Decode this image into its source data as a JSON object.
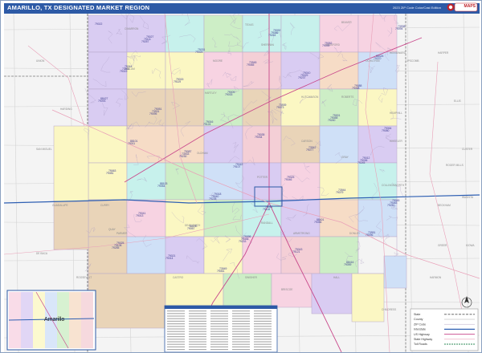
{
  "title": "AMARILLO, TX DESIGNATED MARKET REGION",
  "edition": "2023 ZIP Code Color/Cast Edition",
  "logo_text": "MAPS",
  "inset_city": "Amarillo",
  "legend": {
    "items": [
      "State",
      "County",
      "ZIP Code",
      "Interstate",
      "US Highway",
      "State Highway",
      "Toll Roads"
    ]
  },
  "counties": [
    "DALLAM",
    "HARTLEY",
    "OLDHAM",
    "POTTER",
    "RANDALL",
    "DEAF SMITH",
    "PARMER",
    "CASTRO",
    "SWISHER",
    "BRISCOE",
    "HALL",
    "DONLEY",
    "COLLINGSWORTH",
    "WHEELER",
    "GRAY",
    "CARSON",
    "HUTCHINSON",
    "ROBERTS",
    "HEMPHILL",
    "MOORE",
    "SHERMAN",
    "HANSFORD",
    "OCHILTREE",
    "LIPSCOMB",
    "ARMSTRONG",
    "CHILDRESS",
    "CURRY",
    "QUAY",
    "UNION",
    "HARDING",
    "CIMARRON",
    "TEXAS",
    "BEAVER",
    "HARPER",
    "ELLIS",
    "ROGER MILLS",
    "BECKHAM",
    "GREER",
    "HARMON",
    "WOODWARD",
    "CUSTER",
    "WASHITA",
    "KIOWA",
    "SAN MIGUEL",
    "GUADALUPE",
    "DE BACA",
    "ROOSEVELT",
    "LAMB",
    "HALE"
  ],
  "zip_labels": [
    "79022",
    "79044",
    "79051",
    "79087",
    "79018",
    "79098",
    "79092",
    "79010",
    "79001",
    "79012",
    "79045",
    "79025",
    "79027",
    "79015",
    "79016",
    "79042",
    "79032",
    "79043",
    "79052",
    "79088",
    "79064",
    "79063",
    "79041",
    "79021",
    "79031",
    "79009",
    "79035",
    "79325",
    "88401",
    "88416",
    "88426",
    "88427",
    "88101",
    "88103",
    "88130",
    "73949",
    "73945",
    "73939",
    "73942",
    "73944",
    "73951",
    "73938",
    "73901",
    "73931",
    "73933",
    "79040",
    "79084",
    "79086",
    "79029",
    "79058",
    "79036",
    "79083",
    "79108",
    "79111",
    "79119",
    "79124",
    "79107",
    "79118",
    "79121",
    "79039",
    "79068",
    "79080",
    "79081",
    "79013",
    "79014",
    "79024",
    "79033",
    "79034",
    "79046",
    "79056",
    "79059",
    "79070",
    "79093",
    "79011",
    "79054",
    "79057",
    "79061",
    "79065",
    "79073",
    "79077",
    "79079",
    "79096",
    "79094",
    "79019",
    "79095",
    "79230",
    "79226",
    "79233",
    "79261",
    "79237",
    "79240",
    "79245",
    "79251",
    "79255",
    "79257"
  ],
  "colors": {
    "violet": "#d9ccf2",
    "pink": "#f7d3e2",
    "yellow": "#fbf7c3",
    "green": "#cdeec6",
    "cyan": "#c7f1ec",
    "tan": "#e9d4b8",
    "peach": "#f6dcc6",
    "blue": "#cfe0f7",
    "mint": "#d8f2e3",
    "rose": "#f4cfd6",
    "outside": "#f4f4f4",
    "title_bg": "#2d5aa6",
    "interstate": "#2e5fb3",
    "highway": "#c94a8c",
    "road": "#e9a0b8",
    "state_line": "#777777"
  },
  "map_data": {
    "blocks": [
      {
        "col": 0,
        "row": 0,
        "c": "violet"
      },
      {
        "col": 1,
        "row": 0,
        "c": "violet"
      },
      {
        "col": 2,
        "row": 0,
        "c": "cyan"
      },
      {
        "col": 3,
        "row": 0,
        "c": "green"
      },
      {
        "col": 4,
        "row": 0,
        "c": "cyan"
      },
      {
        "col": 5,
        "row": 0,
        "c": "cyan"
      },
      {
        "col": 6,
        "row": 0,
        "c": "pink"
      },
      {
        "col": 7,
        "row": 0,
        "c": "pink"
      },
      {
        "col": 0,
        "row": 1,
        "c": "violet"
      },
      {
        "col": 1,
        "row": 1,
        "c": "yellow"
      },
      {
        "col": 2,
        "row": 1,
        "c": "yellow"
      },
      {
        "col": 3,
        "row": 1,
        "c": "pink"
      },
      {
        "col": 4,
        "row": 1,
        "c": "rose"
      },
      {
        "col": 5,
        "row": 1,
        "c": "violet"
      },
      {
        "col": 6,
        "row": 1,
        "c": "peach"
      },
      {
        "col": 7,
        "row": 1,
        "c": "blue"
      },
      {
        "col": 0,
        "row": 2,
        "c": "violet"
      },
      {
        "col": 1,
        "row": 2,
        "c": "tan"
      },
      {
        "col": 2,
        "row": 2,
        "c": "tan"
      },
      {
        "col": 3,
        "row": 2,
        "c": "green"
      },
      {
        "col": 4,
        "row": 2,
        "c": "tan"
      },
      {
        "col": 5,
        "row": 2,
        "c": "yellow"
      },
      {
        "col": 6,
        "row": 2,
        "c": "green"
      },
      {
        "col": 7,
        "row": 2,
        "c": "yellow"
      },
      {
        "col": 0,
        "row": 3,
        "c": "yellow"
      },
      {
        "col": 1,
        "row": 3,
        "c": "peach"
      },
      {
        "col": 2,
        "row": 3,
        "c": "peach"
      },
      {
        "col": 3,
        "row": 3,
        "c": "violet"
      },
      {
        "col": 4,
        "row": 3,
        "c": "rose"
      },
      {
        "col": 5,
        "row": 3,
        "c": "tan"
      },
      {
        "col": 6,
        "row": 3,
        "c": "blue"
      },
      {
        "col": 7,
        "row": 3,
        "c": "violet"
      },
      {
        "col": 0,
        "row": 4,
        "c": "yellow"
      },
      {
        "col": 1,
        "row": 4,
        "c": "cyan"
      },
      {
        "col": 2,
        "row": 4,
        "c": "green"
      },
      {
        "col": 3,
        "row": 4,
        "c": "blue"
      },
      {
        "col": 4,
        "row": 4,
        "c": "violet"
      },
      {
        "col": 5,
        "row": 4,
        "c": "pink"
      },
      {
        "col": 6,
        "row": 4,
        "c": "yellow"
      },
      {
        "col": 7,
        "row": 4,
        "c": "cyan"
      },
      {
        "col": 0,
        "row": 5,
        "c": "tan"
      },
      {
        "col": 1,
        "row": 5,
        "c": "pink"
      },
      {
        "col": 2,
        "row": 5,
        "c": "yellow"
      },
      {
        "col": 3,
        "row": 5,
        "c": "green"
      },
      {
        "col": 4,
        "row": 5,
        "c": "cyan"
      },
      {
        "col": 5,
        "row": 5,
        "c": "violet"
      },
      {
        "col": 6,
        "row": 5,
        "c": "peach"
      },
      {
        "col": 7,
        "row": 5,
        "c": "blue"
      },
      {
        "col": 0,
        "row": 6,
        "c": "tan"
      },
      {
        "col": 1,
        "row": 6,
        "c": "blue"
      },
      {
        "col": 2,
        "row": 6,
        "c": "violet"
      },
      {
        "col": 3,
        "row": 6,
        "c": "yellow"
      },
      {
        "col": 4,
        "row": 6,
        "c": "pink"
      },
      {
        "col": 5,
        "row": 6,
        "c": "rose"
      },
      {
        "col": 6,
        "row": 6,
        "c": "green"
      },
      {
        "col": 7,
        "row": 6,
        "c": "outside"
      }
    ]
  }
}
